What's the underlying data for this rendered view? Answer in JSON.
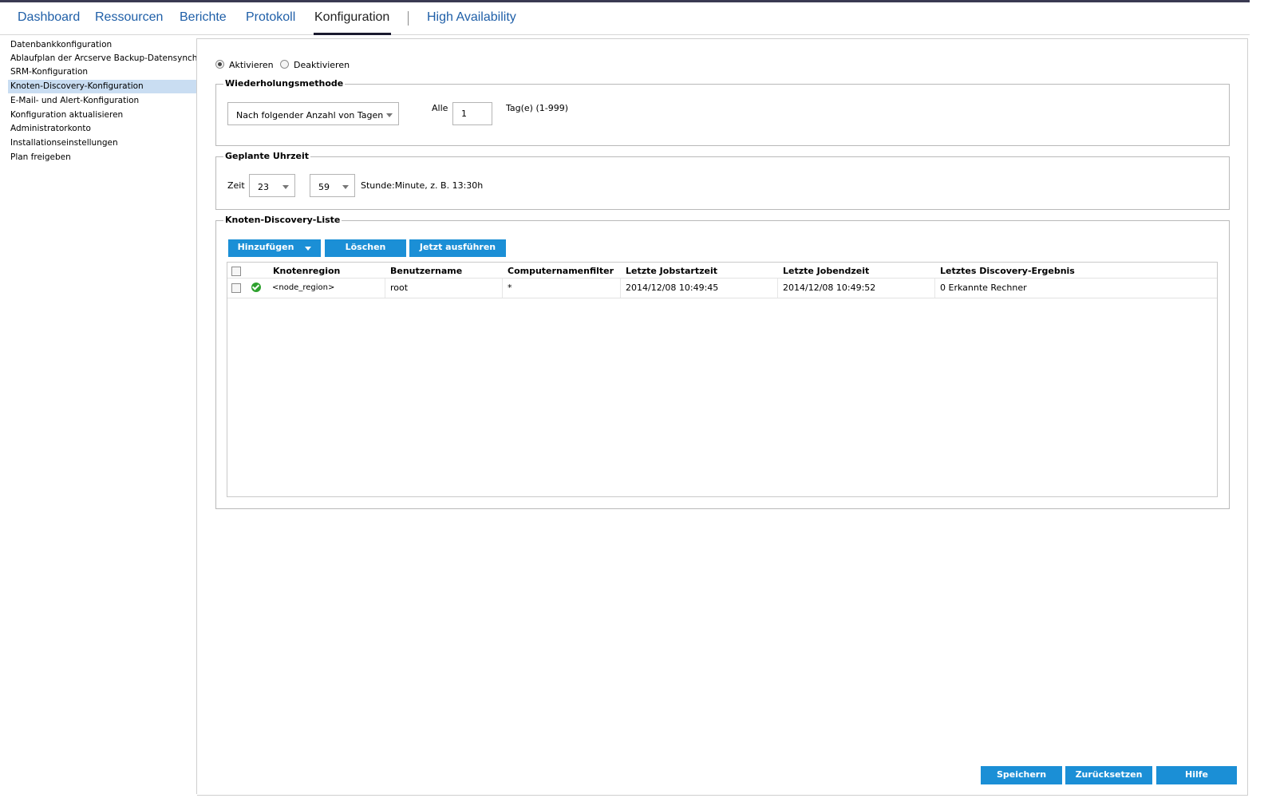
{
  "nav": {
    "items": [
      {
        "label": "Dashboard"
      },
      {
        "label": "Ressourcen"
      },
      {
        "label": "Berichte"
      },
      {
        "label": "Protokoll"
      },
      {
        "label": "Konfiguration"
      },
      {
        "label": "High Availability"
      }
    ],
    "active": "Konfiguration"
  },
  "sidebar": {
    "items": [
      {
        "label": "Datenbankkonfiguration"
      },
      {
        "label": "Ablaufplan der Arcserve Backup-Datensynchro"
      },
      {
        "label": "SRM-Konfiguration"
      },
      {
        "label": "Knoten-Discovery-Konfiguration"
      },
      {
        "label": "E-Mail- und Alert-Konfiguration"
      },
      {
        "label": "Konfiguration aktualisieren"
      },
      {
        "label": "Administratorkonto"
      },
      {
        "label": "Installationseinstellungen"
      },
      {
        "label": "Plan freigeben"
      }
    ],
    "selected": "Knoten-Discovery-Konfiguration"
  },
  "enable": {
    "activate_label": "Aktivieren",
    "deactivate_label": "Deaktivieren",
    "selected": "Aktivieren"
  },
  "repeat": {
    "legend": "Wiederholungsmethode",
    "method_value": "Nach folgender Anzahl von Tagen",
    "every_label": "Alle",
    "days_value": "1",
    "unit_label": "Tag(e) (1-999)"
  },
  "schedule": {
    "legend": "Geplante Uhrzeit",
    "time_label": "Zeit",
    "hour_value": "23",
    "minute_value": "59",
    "hint": "Stunde:Minute, z. B. 13:30h"
  },
  "discovery": {
    "legend": "Knoten-Discovery-Liste",
    "add_button": "Hinzufügen",
    "delete_button": "Löschen",
    "run_button": "Jetzt ausführen",
    "columns": [
      "Knotenregion",
      "Benutzername",
      "Computernamenfilter",
      "Letzte Jobstartzeit",
      "Letzte Jobendzeit",
      "Letztes Discovery-Ergebnis"
    ],
    "rows": [
      {
        "status_icon": "check-circle-icon",
        "region": "<node_region>",
        "user": "root",
        "filter": "*",
        "start": "2014/12/08 10:49:45",
        "end": "2014/12/08 10:49:52",
        "result": "0 Erkannte Rechner"
      }
    ]
  },
  "footer": {
    "save_button": "Speichern",
    "reset_button": "Zurücksetzen",
    "help_button": "Hilfe"
  },
  "colors": {
    "button_blue": "#1b8fd6",
    "nav_link": "#1f5fa8",
    "sidebar_selected": "#c9ddf2",
    "status_ok": "#2ea12e"
  }
}
